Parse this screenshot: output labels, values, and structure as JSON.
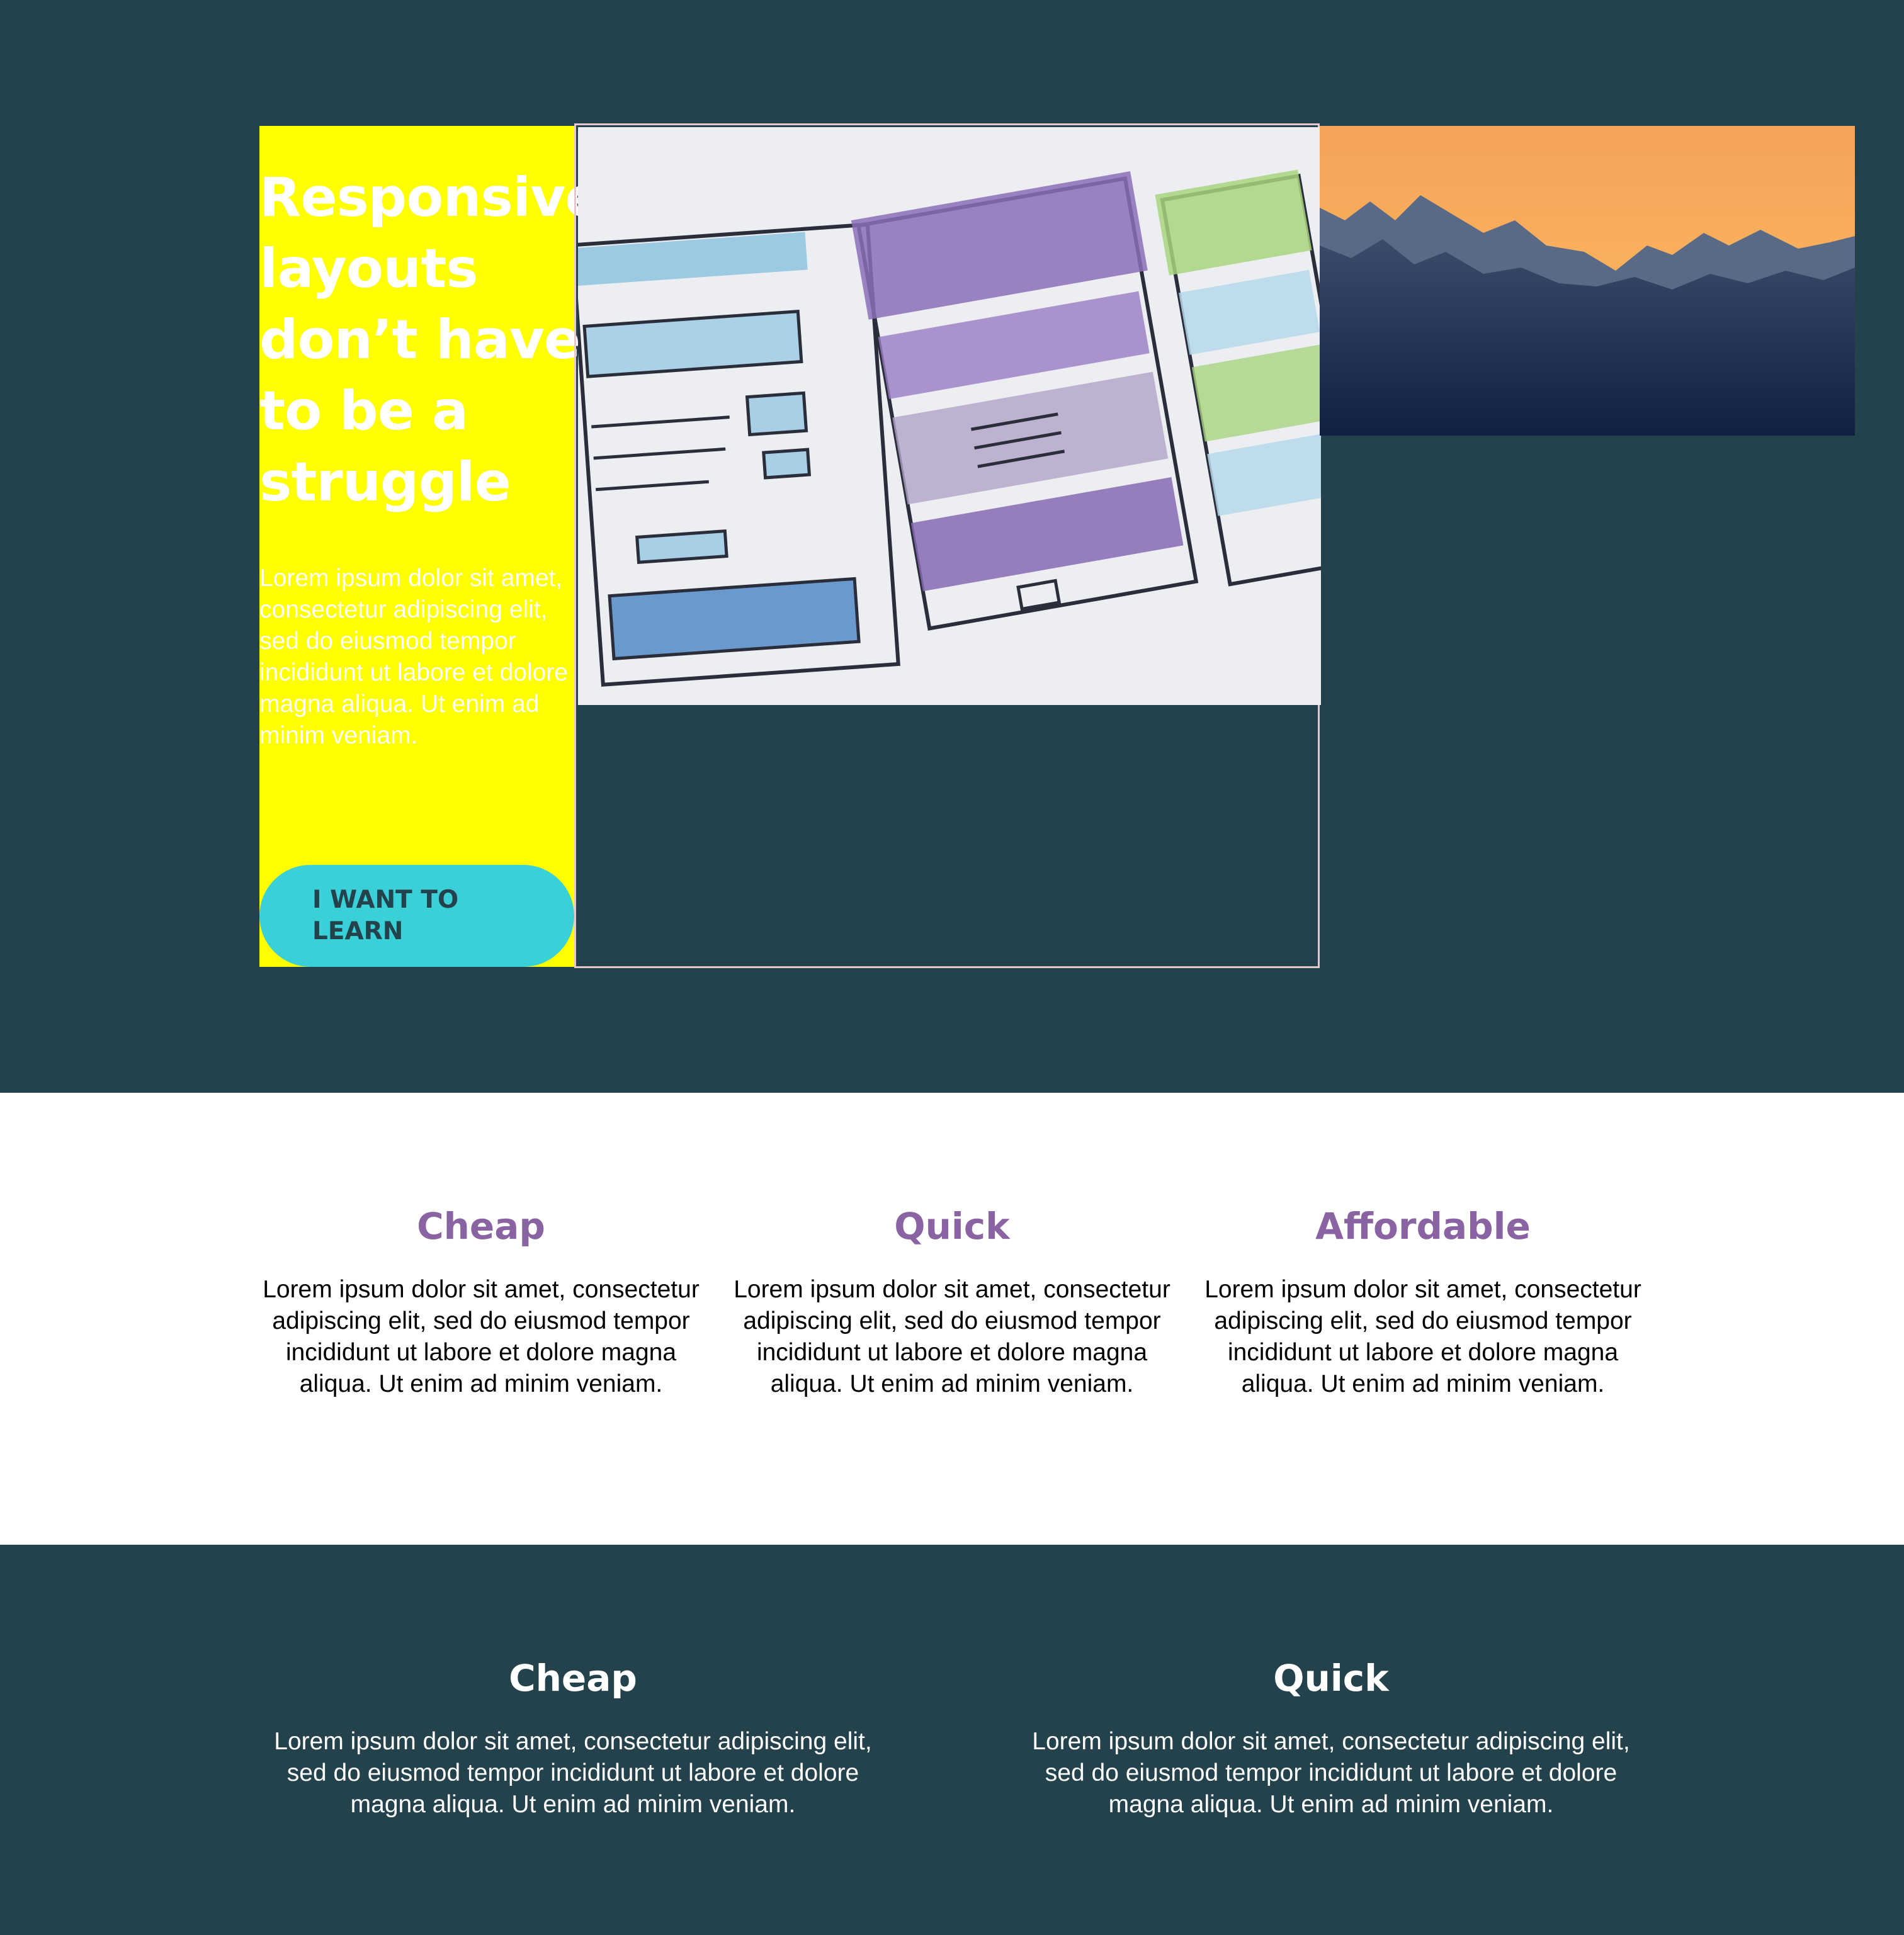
{
  "colors": {
    "background_dark": "#23424b",
    "hero_text_bg": "#ffff00",
    "button_bg": "#3ad0d8",
    "accent_purple": "#8a63a3",
    "white_section_bg": "#ffffff",
    "media_border": "#e7c7d0"
  },
  "hero": {
    "title": "Responsive layouts don’t have to be a struggle",
    "lead": "Lorem ipsum dolor sit amet, consectetur adipiscing elit, sed do eiusmod tempor incididunt ut labore et dolore magna aliqua. Ut enim ad minim veniam.",
    "cta_label": "I WANT TO LEARN",
    "images": {
      "sketch": "wireframe-sketch-image",
      "mountain": "mountain-sunset-image"
    }
  },
  "features": [
    {
      "title": "Cheap",
      "text": "Lorem ipsum dolor sit amet, consectetur adipiscing elit, sed do eiusmod tempor incididunt ut labore et dolore magna aliqua. Ut enim ad minim veniam."
    },
    {
      "title": "Quick",
      "text": "Lorem ipsum dolor sit amet, consectetur adipiscing elit, sed do eiusmod tempor incididunt ut labore et dolore magna aliqua. Ut enim ad minim veniam."
    },
    {
      "title": "Affordable",
      "text": "Lorem ipsum dolor sit amet, consectetur adipiscing elit, sed do eiusmod tempor incididunt ut labore et dolore magna aliqua. Ut enim ad minim veniam."
    }
  ],
  "features_dark": [
    {
      "title": "Cheap",
      "text": "Lorem ipsum dolor sit amet, consectetur adipiscing elit, sed do eiusmod tempor incididunt ut labore et dolore magna aliqua. Ut enim ad minim veniam."
    },
    {
      "title": "Quick",
      "text": "Lorem ipsum dolor sit amet, consectetur adipiscing elit, sed do eiusmod tempor incididunt ut labore et dolore magna aliqua. Ut enim ad minim veniam."
    }
  ]
}
